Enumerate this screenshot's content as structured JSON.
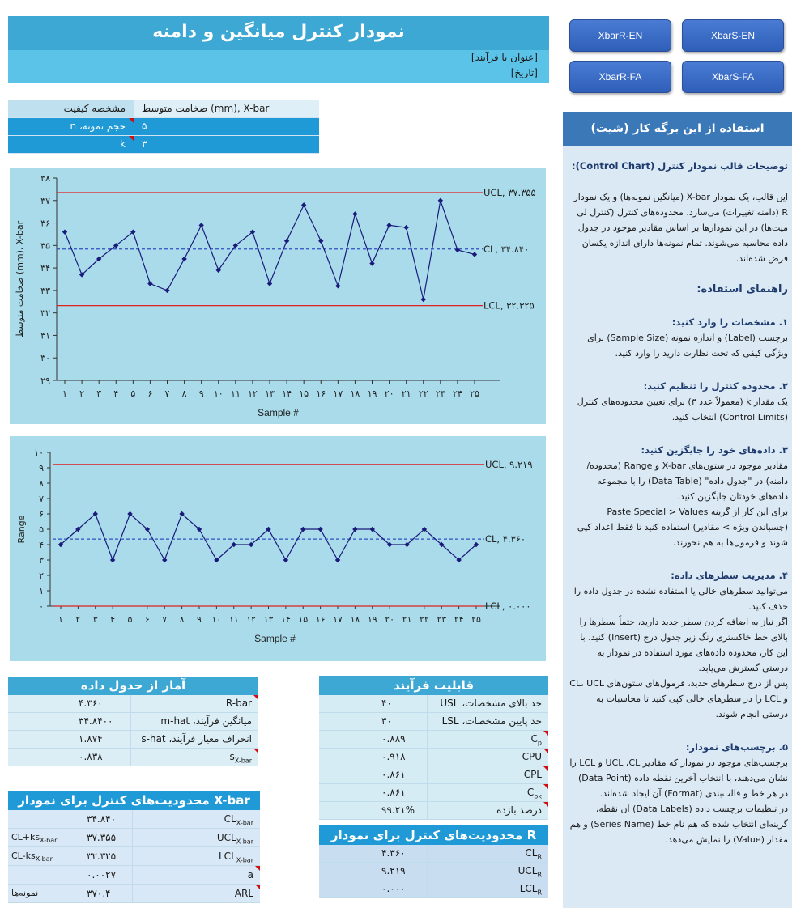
{
  "header": {
    "title": "نمودار کنترل میانگین و دامنه",
    "process_placeholder": "[عنوان یا فرآیند]",
    "date_placeholder": "[تاریخ]"
  },
  "buttons": [
    "XbarR-EN",
    "XbarS-EN",
    "XbarR-FA",
    "XbarS-FA"
  ],
  "spec": {
    "rows": [
      {
        "label": "مشخصه کیفیت",
        "value": "ضخامت متوسط (mm), X-bar",
        "flag": false
      },
      {
        "label": "حجم نمونه، n",
        "value": "۵",
        "flag": true
      },
      {
        "label": "k",
        "value": "۳",
        "flag": true
      }
    ]
  },
  "chart_data": [
    {
      "type": "line",
      "xlabel": "Sample #",
      "ylabel": "ضخامت متوسط (mm), X-bar",
      "ylim": [
        29,
        38
      ],
      "yticks": [
        "۲۹",
        "۳۰",
        "۳۱",
        "۳۲",
        "۳۳",
        "۳۴",
        "۳۵",
        "۳۶",
        "۳۷",
        "۳۸"
      ],
      "x": [
        "۱",
        "۲",
        "۳",
        "۴",
        "۵",
        "۶",
        "۷",
        "۸",
        "۹",
        "۱۰",
        "۱۱",
        "۱۲",
        "۱۳",
        "۱۴",
        "۱۵",
        "۱۶",
        "۱۷",
        "۱۸",
        "۱۹",
        "۲۰",
        "۲۱",
        "۲۲",
        "۲۳",
        "۲۴",
        "۲۵"
      ],
      "values": [
        35.6,
        33.7,
        34.4,
        35.0,
        35.6,
        33.3,
        33.0,
        34.4,
        35.9,
        33.9,
        35.0,
        35.6,
        33.3,
        35.2,
        36.8,
        35.2,
        33.2,
        36.4,
        34.2,
        35.9,
        35.8,
        32.6,
        37.0,
        34.8,
        34.6
      ],
      "lines": [
        {
          "name": "UCL",
          "value": 37.355,
          "label": "UCL, ۳۷.۳۵۵",
          "color": "#e02020",
          "style": "solid"
        },
        {
          "name": "CL",
          "value": 34.84,
          "label": "CL, ۳۴.۸۴۰",
          "color": "#3050c0",
          "style": "dashed"
        },
        {
          "name": "LCL",
          "value": 32.325,
          "label": "LCL, ۳۲.۳۲۵",
          "color": "#e02020",
          "style": "solid"
        }
      ],
      "series_color": "#1a1a7a"
    },
    {
      "type": "line",
      "xlabel": "Sample #",
      "ylabel": "Range",
      "ylim": [
        0,
        10
      ],
      "yticks": [
        "۰",
        "۱",
        "۲",
        "۳",
        "۴",
        "۵",
        "۶",
        "۷",
        "۸",
        "۹",
        "۱۰"
      ],
      "x": [
        "۱",
        "۲",
        "۳",
        "۴",
        "۵",
        "۶",
        "۷",
        "۸",
        "۹",
        "۱۰",
        "۱۱",
        "۱۲",
        "۱۳",
        "۱۴",
        "۱۵",
        "۱۶",
        "۱۷",
        "۱۸",
        "۱۹",
        "۲۰",
        "۲۱",
        "۲۲",
        "۲۳",
        "۲۴",
        "۲۵"
      ],
      "values": [
        4,
        5,
        6,
        3,
        6,
        5,
        3,
        6,
        5,
        3,
        4,
        4,
        5,
        3,
        5,
        5,
        3,
        5,
        5,
        4,
        4,
        5,
        4,
        3,
        4
      ],
      "lines": [
        {
          "name": "UCL",
          "value": 9.219,
          "label": "UCL, ۹.۲۱۹",
          "color": "#e02020",
          "style": "solid"
        },
        {
          "name": "CL",
          "value": 4.36,
          "label": "CL, ۴.۳۶۰",
          "color": "#3050c0",
          "style": "dashed"
        },
        {
          "name": "LCL",
          "value": 0,
          "label": "LCL, ۰.۰۰۰",
          "color": "#e02020",
          "style": "solid"
        }
      ],
      "series_color": "#1a1a7a"
    }
  ],
  "stats": {
    "title": "آمار از جدول داده",
    "rows": [
      {
        "label": "R-bar",
        "sub": "",
        "value": "۴.۳۶۰",
        "flag": true
      },
      {
        "label": "میانگین فرآیند، m-hat",
        "sub": "",
        "value": "۳۴.۸۴۰۰",
        "flag": false
      },
      {
        "label": "انحراف معیار فرآیند، s-hat",
        "sub": "",
        "value": "۱.۸۷۴",
        "flag": false
      },
      {
        "label": "s",
        "sub": "X-bar",
        "value": "۰.۸۳۸",
        "flag": true
      }
    ]
  },
  "capability": {
    "title": "قابلیت فرآیند",
    "rows": [
      {
        "label": "حد بالای مشخصات، USL",
        "sub": "",
        "value": "۴۰",
        "flag": false
      },
      {
        "label": "حد پایین مشخصات، LSL",
        "sub": "",
        "value": "۳۰",
        "flag": false
      },
      {
        "label": "C",
        "sub": "p",
        "value": "۰.۸۸۹",
        "flag": true
      },
      {
        "label": "CPU",
        "sub": "",
        "value": "۰.۹۱۸",
        "flag": true
      },
      {
        "label": "CPL",
        "sub": "",
        "value": "۰.۸۶۱",
        "flag": true
      },
      {
        "label": "C",
        "sub": "pk",
        "value": "۰.۸۶۱",
        "flag": true
      },
      {
        "label": "درصد بازده",
        "sub": "",
        "value": "۹۹.۲۱%",
        "flag": true
      }
    ]
  },
  "xbar_limits": {
    "title": "محدودیت‌های کنترل برای نمودار X-bar",
    "rows": [
      {
        "label": "CL",
        "sub": "X-bar",
        "value": "۳۴.۸۴۰",
        "note": "",
        "note_sub": "",
        "flag": false
      },
      {
        "label": "UCL",
        "sub": "X-bar",
        "value": "۳۷.۳۵۵",
        "note": "CL+ks",
        "note_sub": "X-bar",
        "flag": false
      },
      {
        "label": "LCL",
        "sub": "X-bar",
        "value": "۳۲.۳۲۵",
        "note": "CL-ks",
        "note_sub": "X-bar",
        "flag": false
      },
      {
        "label": "a",
        "sub": "",
        "value": "۰.۰۰۲۷",
        "note": "",
        "note_sub": "",
        "flag": true
      },
      {
        "label": "ARL",
        "sub": "",
        "value": "۳۷۰.۴",
        "note": "نمونه‌ها",
        "note_sub": "",
        "flag": true
      }
    ]
  },
  "r_limits": {
    "title": "محدودیت‌های کنترل برای نمودار R",
    "rows": [
      {
        "label": "CL",
        "sub": "R",
        "value": "۴.۳۶۰"
      },
      {
        "label": "UCL",
        "sub": "R",
        "value": "۹.۲۱۹"
      },
      {
        "label": "LCL",
        "sub": "R",
        "value": "۰.۰۰۰"
      }
    ]
  },
  "sidebar": {
    "title": "استفاده از این برگه کار (شیت)",
    "desc_title": "توضیحات قالب نمودار کنترل (Control Chart):",
    "desc": "این قالب، یک نمودار X-bar (میانگین نمونه‌ها) و یک نمودار R (دامنه تغییرات) می‌سازد. محدوده‌های کنترل (کنترل لی میت‌ها) در این نمودارها بر اساس مقادیر موجود در جدول داده محاسبه می‌شوند. تمام نمونه‌ها دارای اندازه یکسان فرض شده‌اند.",
    "guide_title": "راهنمای استفاده:",
    "steps": [
      {
        "title": "۱. مشخصات را وارد کنید:",
        "paras": [
          "برچسب (Label) و اندازه نمونه (Sample Size) برای ویژگی کیفی که تحت نظارت دارید را وارد کنید."
        ]
      },
      {
        "title": "۲. محدوده کنترل را تنظیم کنید:",
        "paras": [
          "یک مقدار k (معمولاً عدد ۳) برای تعیین محدوده‌های کنترل (Control Limits) انتخاب کنید."
        ]
      },
      {
        "title": "۳. داده‌های خود را جایگزین کنید:",
        "paras": [
          "مقادیر موجود در ستون‌های X-bar و Range (محدوده/دامنه) در \"جدول داده\" (Data Table) را با مجموعه داده‌های خودتان جایگزین کنید.",
          "برای این کار از گزینه Paste Special > Values (چسباندن ویژه > مقادیر) استفاده کنید تا فقط اعداد کپی شوند و فرمول‌ها به هم نخورند."
        ]
      },
      {
        "title": "۴. مدیریت سطرهای داده:",
        "paras": [
          "می‌توانید سطرهای خالی یا استفاده نشده در جدول داده را حذف کنید.",
          "اگر نیاز به اضافه کردن سطر جدید دارید، حتماً سطرها را بالای خط خاکستری رنگ زیر جدول درج (Insert) کنید. با این کار، محدوده داده‌های مورد استفاده در نمودار به درستی گسترش می‌یابد.",
          "پس از درج سطرهای جدید، فرمول‌های ستون‌های CL، UCL و LCL را در سطرهای خالی کپی کنید تا محاسبات به درستی انجام شوند."
        ]
      },
      {
        "title": "۵. برچسب‌های نمودار:",
        "paras": [
          "برچسب‌های موجود در نمودار که مقادیر UCL ،CL و LCL را نشان می‌دهند، با انتخاب آخرین نقطه داده (Data Point) در هر خط و قالب‌بندی (Format) آن ایجاد شده‌اند.",
          "در تنظیمات برچسب داده (Data Labels) آن نقطه، گزینه‌ای انتخاب شده که هم نام خط (Series Name) و هم مقدار (Value) را نمایش می‌دهد."
        ]
      }
    ]
  }
}
